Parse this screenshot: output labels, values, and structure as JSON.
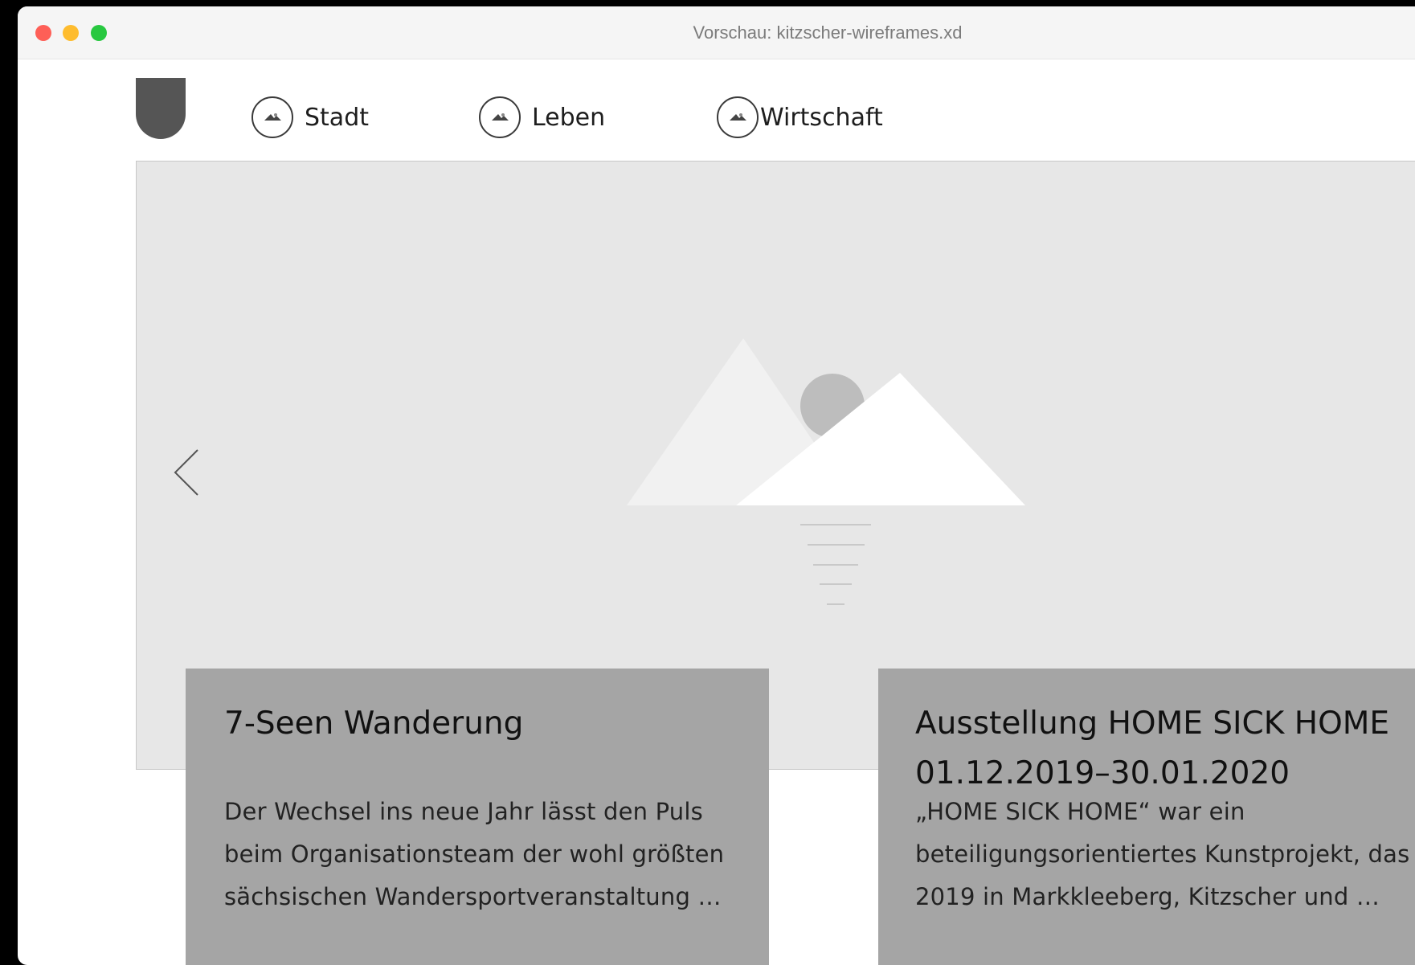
{
  "window": {
    "title": "Vorschau: kitzscher-wireframes.xd"
  },
  "nav": {
    "items": [
      {
        "label": "Stadt",
        "icon": "landscape-icon"
      },
      {
        "label": "Leben",
        "icon": "landscape-icon"
      },
      {
        "label": "Wirtschaft",
        "icon": "landscape-icon"
      }
    ]
  },
  "hero": {
    "prev_icon": "chevron-left-icon",
    "image_icon": "image-placeholder-icon"
  },
  "cards": [
    {
      "title": "7-Seen Wanderung",
      "text_lines": [
        "Der Wechsel ins neue Jahr lässt den Puls",
        "beim Organisationsteam der wohl größten",
        "sächsischen Wandersportveranstaltung …"
      ]
    },
    {
      "title_lines": [
        "Ausstellung HOME SICK HOME",
        "01.12.2019–30.01.2020"
      ],
      "text_lines": [
        "„HOME SICK HOME“ war ein",
        "beteiligungsorientiertes Kunstprojekt, das",
        "2019 in Markkleeberg, Kitzscher und …"
      ]
    }
  ],
  "colors": {
    "hero_bg": "#e7e7e7",
    "card_bg": "#a5a5a5",
    "logo": "#555555"
  }
}
